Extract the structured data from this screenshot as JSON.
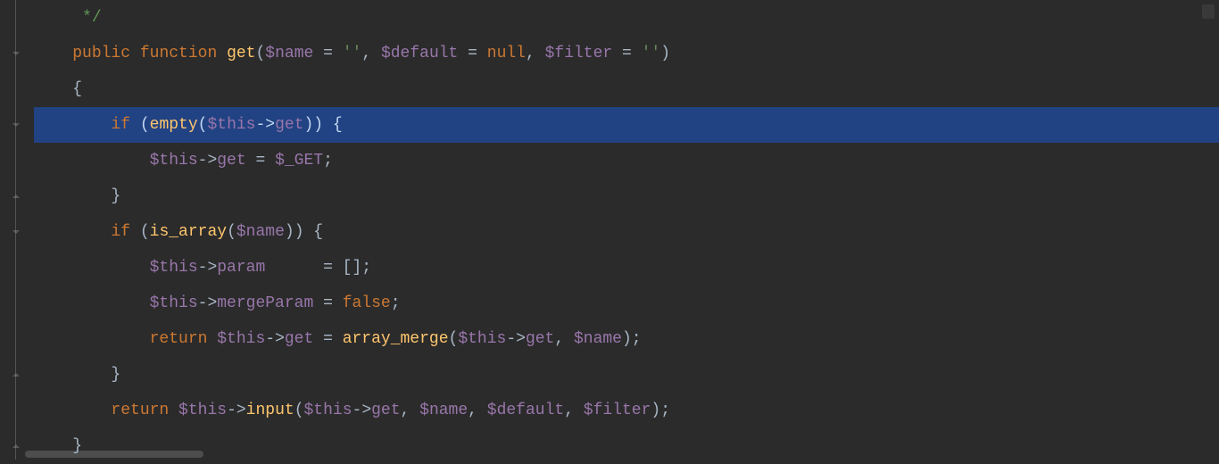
{
  "code": {
    "line1": {
      "comment_close": "*/"
    },
    "line2": {
      "kw_public": "public",
      "kw_function": "function",
      "func_name": "get",
      "p1": "$name",
      "eq1": " = ",
      "str1": "''",
      "comma1": ", ",
      "p2": "$default",
      "eq2": " = ",
      "null_kw": "null",
      "comma2": ", ",
      "p3": "$filter",
      "eq3": " = ",
      "str2": "''",
      "rparen": ")"
    },
    "line3": {
      "brace": "{"
    },
    "line4": {
      "kw_if": "if",
      "open": " (",
      "func_empty": "empty",
      "open2": "(",
      "this": "$this",
      "arrow": "->",
      "prop": "get",
      "close": ")) {"
    },
    "line5": {
      "this": "$this",
      "arrow": "->",
      "prop": "get",
      "eq": " = ",
      "superglobal": "$_GET",
      "semi": ";"
    },
    "line6": {
      "brace": "}"
    },
    "line7": {
      "kw_if": "if",
      "open": " (",
      "func": "is_array",
      "open2": "(",
      "var": "$name",
      "close": ")) {"
    },
    "line8": {
      "this": "$this",
      "arrow": "->",
      "prop": "param",
      "spaces": "      ",
      "eq": "= [];"
    },
    "line9": {
      "this": "$this",
      "arrow": "->",
      "prop": "mergeParam",
      "eq": " = ",
      "false_kw": "false",
      "semi": ";"
    },
    "line10": {
      "kw_return": "return",
      "sp": " ",
      "this1": "$this",
      "arrow1": "->",
      "prop1": "get",
      "eq": " = ",
      "func": "array_merge",
      "open": "(",
      "this2": "$this",
      "arrow2": "->",
      "prop2": "get",
      "comma": ", ",
      "var": "$name",
      "close": ");"
    },
    "line11": {
      "brace": "}"
    },
    "line12": {
      "kw_return": "return",
      "sp": " ",
      "this1": "$this",
      "arrow1": "->",
      "method": "input",
      "open": "(",
      "this2": "$this",
      "arrow2": "->",
      "prop": "get",
      "comma1": ", ",
      "var1": "$name",
      "comma2": ", ",
      "var2": "$default",
      "comma3": ", ",
      "var3": "$filter",
      "close": ");"
    },
    "line13": {
      "brace": "}"
    }
  }
}
